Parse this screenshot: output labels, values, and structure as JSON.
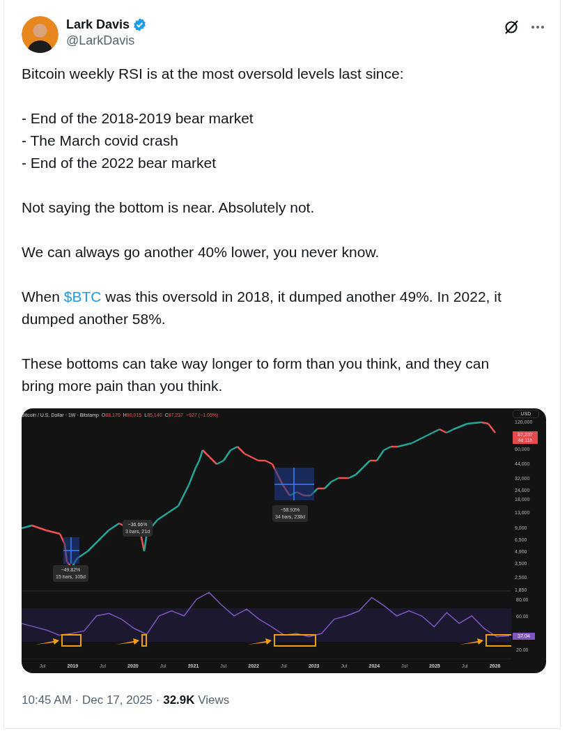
{
  "author": {
    "name": "Lark Davis",
    "handle": "@LarkDavis"
  },
  "body": [
    {
      "lines": [
        [
          {
            "text": "Bitcoin weekly RSI is at the most oversold levels last since:",
            "kind": "text"
          }
        ]
      ]
    },
    {
      "lines": [
        [
          {
            "text": "- End of the 2018-2019 bear market",
            "kind": "text"
          }
        ],
        [
          {
            "text": "- The March covid crash",
            "kind": "text"
          }
        ],
        [
          {
            "text": "- End of the 2022 bear market",
            "kind": "text"
          }
        ]
      ]
    },
    {
      "lines": [
        [
          {
            "text": "Not saying the bottom is near. Absolutely not.",
            "kind": "text"
          }
        ]
      ]
    },
    {
      "lines": [
        [
          {
            "text": "We can always go another 40% lower, you never know.",
            "kind": "text"
          }
        ]
      ]
    },
    {
      "lines": [
        [
          {
            "text": "When ",
            "kind": "text"
          },
          {
            "text": "$BTC",
            "kind": "cashtag"
          },
          {
            "text": " was this oversold in 2018, it dumped another 49%. In 2022, it dumped another 58%.",
            "kind": "text"
          }
        ]
      ]
    },
    {
      "lines": [
        [
          {
            "text": "These bottoms can take way longer to form than you think, and they can bring more pain than you think.",
            "kind": "text"
          }
        ]
      ]
    }
  ],
  "chart": {
    "symbol": "Bitcoin / U.S. Dollar · 1W · Bitstamp",
    "ohlc": [
      {
        "label": "O",
        "value": "88,170"
      },
      {
        "label": "H",
        "value": "90,015"
      },
      {
        "label": "L",
        "value": "85,140"
      },
      {
        "label": "C",
        "value": "87,237"
      }
    ],
    "change": "−927 (−1.05%)",
    "currency": "USD",
    "price_tag": {
      "price": "87,237",
      "countdown": "4d 11h"
    },
    "price_axis": [
      "120,000",
      "60,000",
      "44,000",
      "32,000",
      "24,000",
      "18,000",
      "13,000",
      "9,000",
      "6,500",
      "4,900",
      "3,500",
      "2,500",
      "1,850"
    ],
    "rsi_tag": "37.04",
    "time_axis": [
      {
        "text": "Jul",
        "kind": "month"
      },
      {
        "text": "2019",
        "kind": "year"
      },
      {
        "text": "Jul",
        "kind": "month"
      },
      {
        "text": "2020",
        "kind": "year"
      },
      {
        "text": "Jul",
        "kind": "month"
      },
      {
        "text": "2021",
        "kind": "year"
      },
      {
        "text": "Jul",
        "kind": "month"
      },
      {
        "text": "2022",
        "kind": "year"
      },
      {
        "text": "Jul",
        "kind": "month"
      },
      {
        "text": "2023",
        "kind": "year"
      },
      {
        "text": "Jul",
        "kind": "month"
      },
      {
        "text": "2024",
        "kind": "year"
      },
      {
        "text": "Jul",
        "kind": "month"
      },
      {
        "text": "2025",
        "kind": "year"
      },
      {
        "text": "Jul",
        "kind": "month"
      },
      {
        "text": "2026",
        "kind": "year"
      }
    ],
    "measurements": [
      {
        "change": "−49.82%",
        "span": "15 bars, 105d"
      },
      {
        "change": "−36.66%",
        "span": "3 bars, 21d"
      },
      {
        "change": "−58.93%",
        "span": "34 bars, 238d"
      }
    ],
    "chart_data": {
      "type": "line",
      "series": [
        {
          "color": "#7e57c2",
          "values": [
            52,
            48,
            44,
            38,
            40,
            43,
            61,
            64,
            57,
            46,
            39,
            61,
            67,
            61,
            81,
            89,
            74,
            61,
            69,
            57,
            48,
            38,
            40,
            36,
            40,
            57,
            61,
            67,
            83,
            73,
            61,
            67,
            61,
            48,
            65,
            52,
            61,
            46,
            36,
            37
          ]
        }
      ],
      "ylim": [
        10,
        90
      ],
      "yticks": [
        {
          "value": 80,
          "label": "80.00"
        },
        {
          "value": 60,
          "label": "60.00"
        },
        {
          "value": 20,
          "label": "20.00"
        }
      ]
    }
  },
  "footer": "10:45 AM · Dec 17, 2025 · **32.9K** Views"
}
